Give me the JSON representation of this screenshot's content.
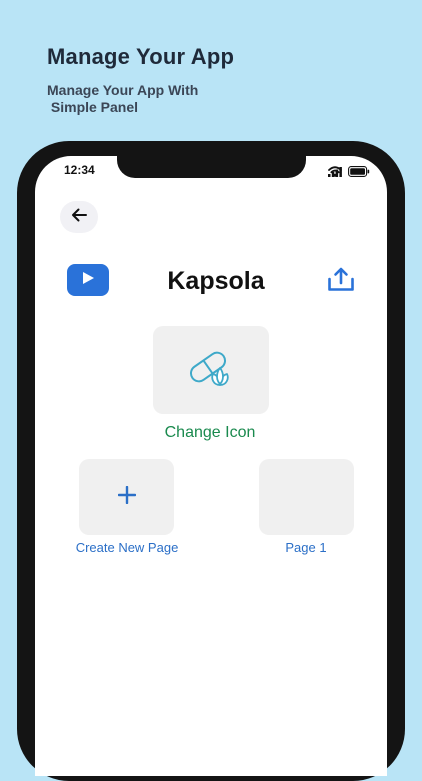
{
  "promo": {
    "title": "Manage Your App",
    "subtitle": "Manage Your App With\n Simple Panel"
  },
  "status_bar": {
    "time": "12:34",
    "icons": [
      "signal-icon",
      "wifi-icon",
      "battery-icon"
    ]
  },
  "header": {
    "back_icon": "arrow-left-icon",
    "play_icon": "play-icon",
    "app_name": "Kapsola",
    "upload_icon": "upload-icon"
  },
  "app_icon": {
    "icon": "capsule-leaf-icon",
    "change_label": "Change Icon"
  },
  "pages": [
    {
      "label": "Create New Page",
      "icon": "plus-icon"
    },
    {
      "label": "Page 1"
    }
  ],
  "colors": {
    "background": "#b9e4f6",
    "accent_blue": "#2a72d9",
    "link_blue": "#2b6fc7",
    "green": "#1a8a4e",
    "tile": "#f0f0f0"
  }
}
